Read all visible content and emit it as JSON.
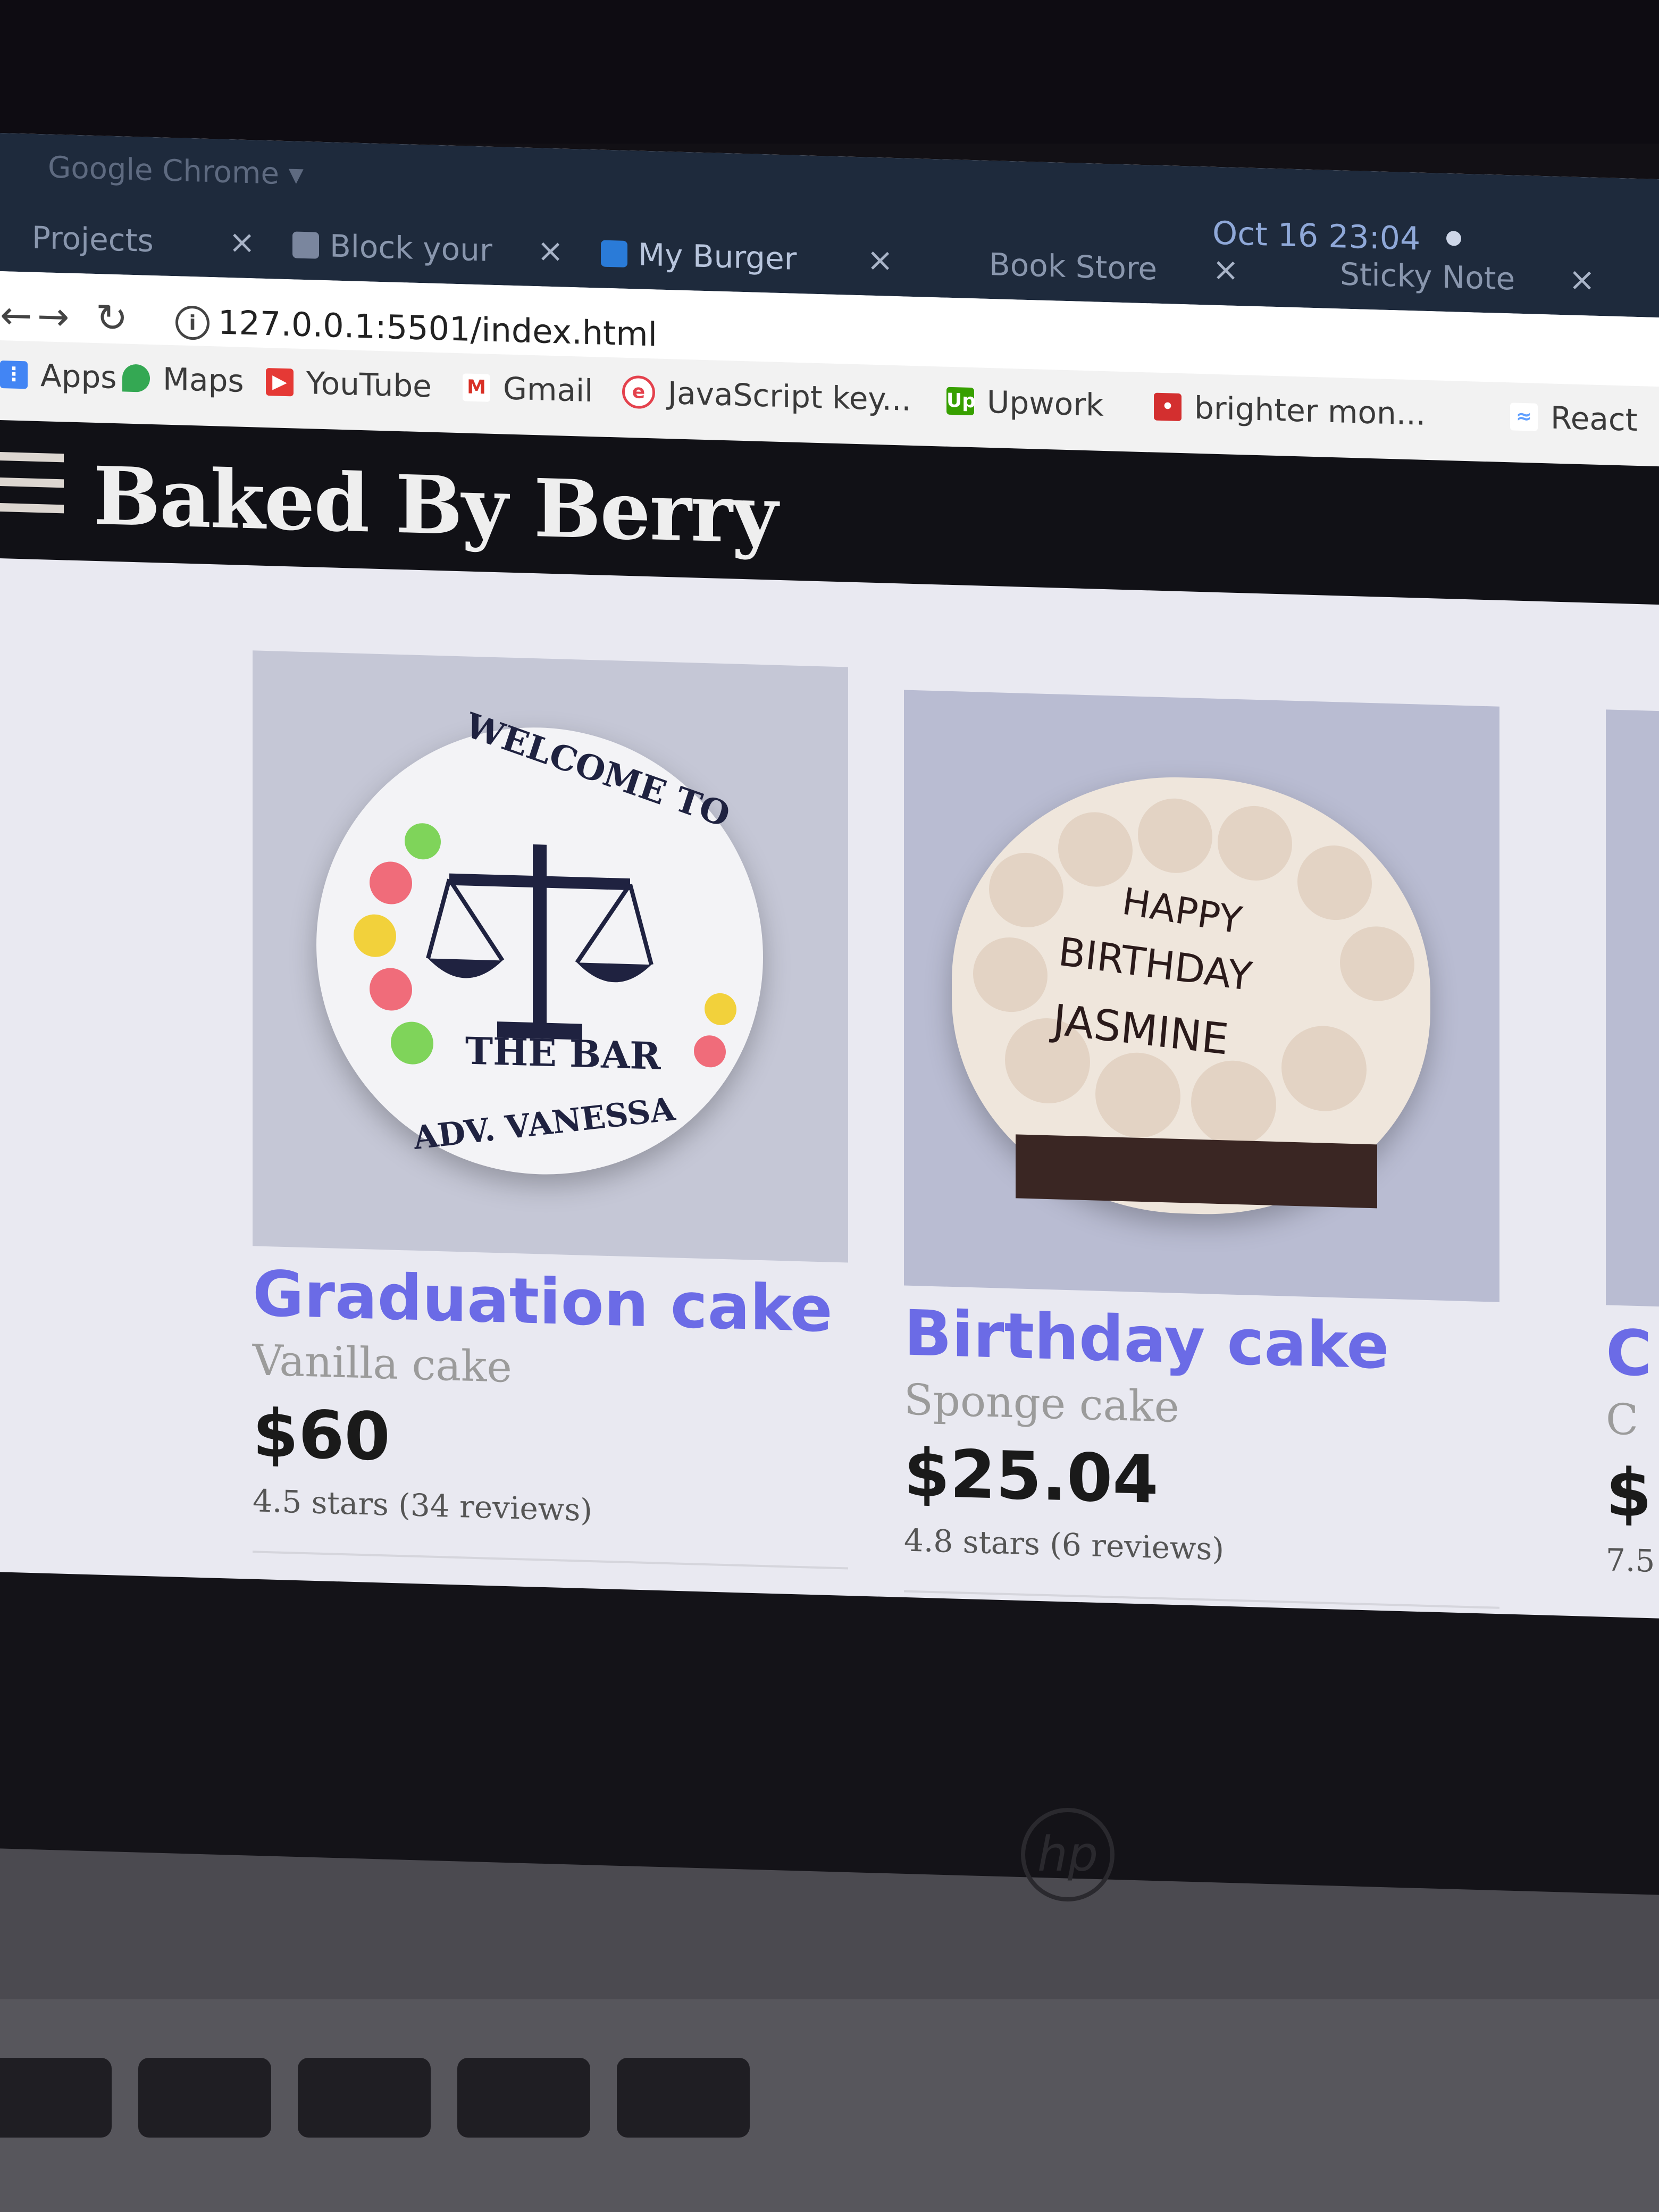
{
  "os_bar": {
    "app_name": "Google Chrome ▾",
    "clock": "Oct 16 23:04"
  },
  "tabs": [
    {
      "label": "Projects",
      "active": false
    },
    {
      "label": "Block your",
      "active": false
    },
    {
      "label": "My Burger",
      "active": true
    },
    {
      "label": "Book Store",
      "active": false
    },
    {
      "label": "Sticky Note",
      "active": false
    }
  ],
  "address": {
    "url": "127.0.0.1:5501/index.html"
  },
  "bookmarks": [
    {
      "label": "Apps",
      "icon": "apps-grid-icon",
      "color": "#4285f4"
    },
    {
      "label": "Maps",
      "icon": "maps-pin-icon",
      "color": "#34a853"
    },
    {
      "label": "YouTube",
      "icon": "youtube-icon",
      "color": "#e53935"
    },
    {
      "label": "Gmail",
      "icon": "gmail-icon",
      "color": "#d93025"
    },
    {
      "label": "JavaScript key...",
      "icon": "javascript-icon",
      "color": "#e4424d"
    },
    {
      "label": "Upwork",
      "icon": "upwork-icon",
      "color": "#37a000"
    },
    {
      "label": "brighter mon...",
      "icon": "brighter-icon",
      "color": "#d32f2f"
    },
    {
      "label": "React",
      "icon": "react-icon",
      "color": "#61a0ff"
    }
  ],
  "site": {
    "title": "Baked By Berry"
  },
  "products": [
    {
      "name": "Graduation cake",
      "flavor": "Vanilla cake",
      "price": "$60",
      "rating": "4.5 stars (34 reviews)",
      "cake_text": [
        "WELCOME TO",
        "THE BAR",
        "ADV. VANESSA"
      ]
    },
    {
      "name": "Birthday cake",
      "flavor": "Sponge cake",
      "price": "$25.04",
      "rating": "4.8 stars (6 reviews)",
      "cake_text": [
        "HAPPY",
        "BIRTHDAY",
        "JASMINE"
      ]
    },
    {
      "name": "C",
      "flavor": "C",
      "price": "$",
      "rating": "7.5"
    }
  ],
  "colors": {
    "product_name": "#6b6be6",
    "header_bg": "#111116",
    "price": "#1a1a1a"
  },
  "bezel": {
    "brand": "hp"
  }
}
